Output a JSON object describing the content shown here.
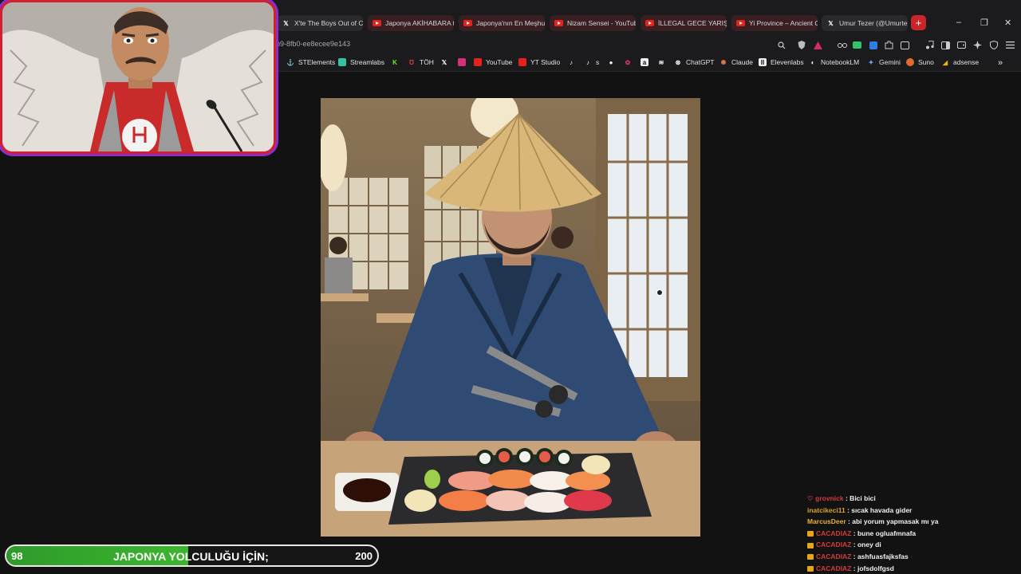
{
  "tabs": [
    {
      "label": "X'te The Boys Out of C",
      "icon": "x-icon"
    },
    {
      "label": "Japonya AKİHABARA t",
      "icon": "youtube-icon"
    },
    {
      "label": "Japonya'nın En Meşhur",
      "icon": "youtube-icon"
    },
    {
      "label": "Nizam Sensei - YouTub",
      "icon": "youtube-icon"
    },
    {
      "label": "İLLEGAL GECE YARIŞIN",
      "icon": "youtube-icon"
    },
    {
      "label": "Yi Province – Ancient C",
      "icon": "youtube-icon"
    },
    {
      "label": "Umur Tezer (@Umurte",
      "icon": "x-icon"
    }
  ],
  "new_tab_label": "+",
  "window_controls": {
    "minimize": "–",
    "restore": "❐",
    "close": "✕"
  },
  "address": {
    "url": "b9-8fb0-ee8ecee9e143"
  },
  "bookmarks": [
    {
      "label": "STElements",
      "icon": "st-icon"
    },
    {
      "label": "Streamlabs",
      "icon": "streamlabs-icon"
    },
    {
      "label": "",
      "icon": "kick-icon"
    },
    {
      "label": "TÖH",
      "icon": "toh-icon"
    },
    {
      "label": "",
      "icon": "x-icon"
    },
    {
      "label": "",
      "icon": "instagram-icon"
    },
    {
      "label": "YouTube",
      "icon": "youtube-icon"
    },
    {
      "label": "YT Studio",
      "icon": "yt-studio-icon"
    },
    {
      "label": "",
      "icon": "tiktok-icon"
    },
    {
      "label": "s",
      "icon": "tiktok-icon"
    },
    {
      "label": "",
      "icon": "circle-icon"
    },
    {
      "label": "",
      "icon": "flower-icon"
    },
    {
      "label": "",
      "icon": "amazon-icon"
    },
    {
      "label": "",
      "icon": "zap-icon"
    },
    {
      "label": "ChatGPT",
      "icon": "chatgpt-icon"
    },
    {
      "label": "Claude",
      "icon": "claude-icon"
    },
    {
      "label": "Elevenlabs",
      "icon": "elevenlabs-icon"
    },
    {
      "label": "NotebookLM",
      "icon": "notebooklm-icon"
    },
    {
      "label": "Gemini",
      "icon": "gemini-icon"
    },
    {
      "label": "Suno",
      "icon": "suno-icon"
    },
    {
      "label": "adsense",
      "icon": "adsense-icon"
    }
  ],
  "bookmarks_more": "»",
  "chat": [
    {
      "user": "grovnick",
      "text": ": Bici bici",
      "user_color": "#d23b3b",
      "badge": "heart"
    },
    {
      "user": "inatcikeci11",
      "text": ": sıcak havada gider",
      "user_color": "#e0a21c",
      "badge": ""
    },
    {
      "user": "MarcusDeer",
      "text": ": abi yorum yapmasak mı ya",
      "user_color": "#e5b23a",
      "badge": ""
    },
    {
      "user": "CACADIAZ",
      "text": ": bune ogluafmnafa",
      "user_color": "#d23b3b",
      "badge": "box"
    },
    {
      "user": "CACADIAZ",
      "text": ": oney di",
      "user_color": "#d23b3b",
      "badge": "box"
    },
    {
      "user": "CACADIAZ",
      "text": ": ashfuasfajksfas",
      "user_color": "#d23b3b",
      "badge": "box"
    },
    {
      "user": "CACADIAZ",
      "text": ": jofsdolfgsd",
      "user_color": "#d23b3b",
      "badge": "box"
    }
  ],
  "goal": {
    "current": "98",
    "label": "JAPONYA YOLCULUĞU İÇİN;",
    "target": "200",
    "progress": 0.49
  },
  "colors": {
    "accent_red": "#d41f2e",
    "accent_purple": "#8a2ec9",
    "goal_green": "#3db52f"
  }
}
